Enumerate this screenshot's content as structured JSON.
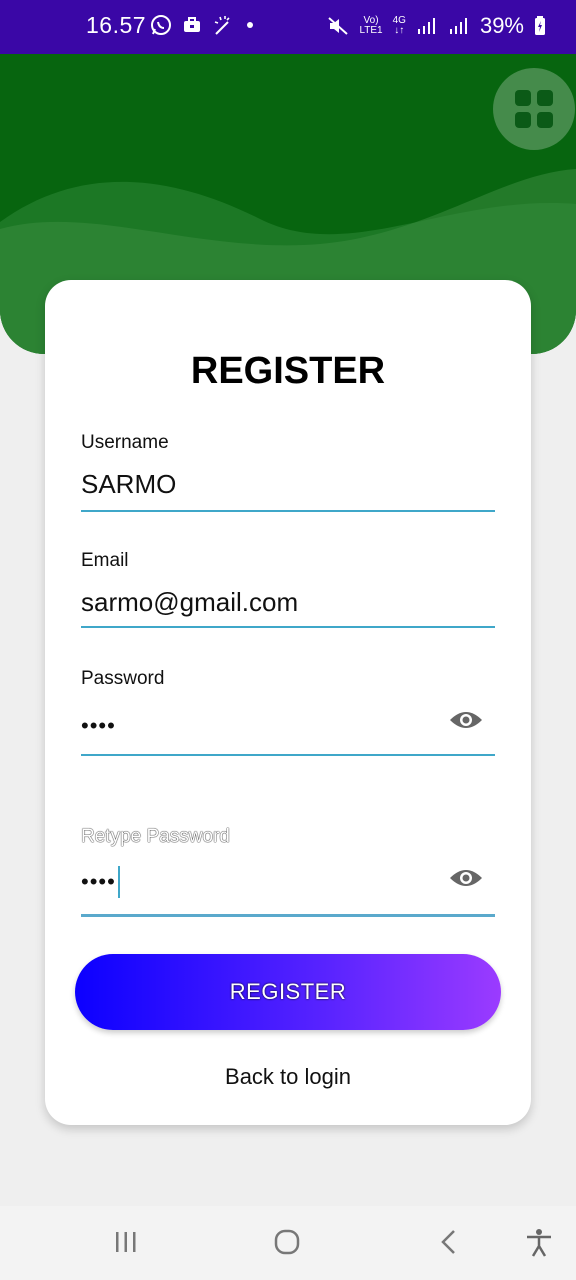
{
  "status_bar": {
    "time": "16.57",
    "battery": "39%",
    "network_top": "Vo)",
    "network_bottom": "LTE1",
    "net_type": "4G",
    "icons": [
      "whatsapp-icon",
      "briefcase-icon",
      "magic-wand-icon",
      "dot-icon",
      "mute-icon",
      "signal-icon",
      "battery-icon"
    ]
  },
  "header": {
    "menu_icon": "grid-icon",
    "accent": "#07650f"
  },
  "form": {
    "title": "REGISTER",
    "username": {
      "label": "Username",
      "value": "SARMO"
    },
    "email": {
      "label": "Email",
      "value": "sarmo@gmail.com"
    },
    "password": {
      "label": "Password",
      "value": "••••",
      "toggle_icon": "eye-icon"
    },
    "retype_password": {
      "label": "Retype Password",
      "value": "••••",
      "toggle_icon": "eye-icon"
    },
    "submit_label": "REGISTER",
    "back_label": "Back to login",
    "line_color": "#3fa7c9"
  },
  "nav": {
    "icons": [
      "recent-apps-icon",
      "home-icon",
      "back-icon",
      "accessibility-icon"
    ]
  }
}
